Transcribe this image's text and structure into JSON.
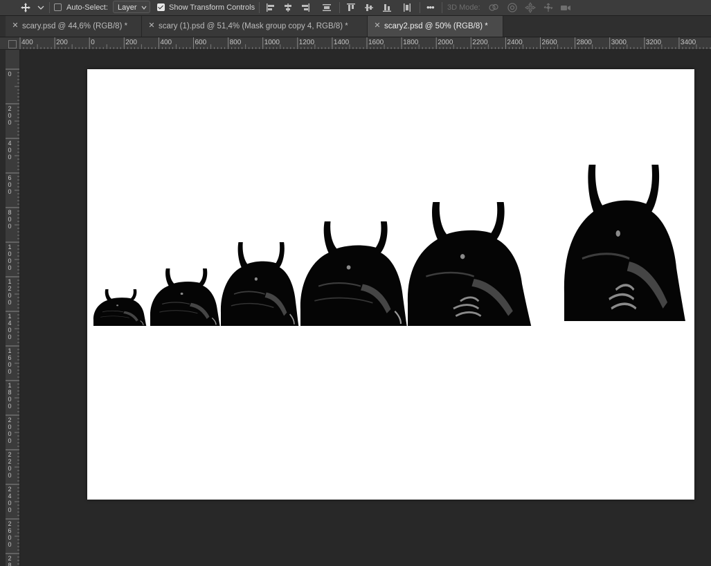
{
  "options_bar": {
    "auto_select_label": "Auto-Select:",
    "auto_select_checked": false,
    "auto_select_target": "Layer",
    "show_transform_label": "Show Transform Controls",
    "show_transform_checked": true,
    "more_label": "•••",
    "mode_3d_label": "3D Mode:",
    "icons": [
      "move-tool-icon",
      "chevron-down-icon",
      "align-left-icon",
      "align-center-icon",
      "align-right-icon",
      "distribute-icon",
      "align-top-icon",
      "align-middle-icon",
      "align-bottom-icon",
      "distribute-vertical-icon",
      "orbit-3d-icon",
      "roll-3d-icon",
      "pan-3d-icon",
      "slide-3d-icon",
      "camera-3d-icon"
    ]
  },
  "tabs": [
    {
      "title": "scary.psd @ 44,6% (RGB/8) *",
      "active": false
    },
    {
      "title": "scary (1).psd @ 51,4% (Mask group copy 4, RGB/8) *",
      "active": false
    },
    {
      "title": "scary2.psd @ 50% (RGB/8) *",
      "active": true
    }
  ],
  "rulers": {
    "horizontal_labels": [
      "400",
      "200",
      "0",
      "200",
      "400",
      "600",
      "800",
      "1000",
      "1200",
      "1400",
      "1600",
      "1800",
      "2000",
      "2200",
      "2400",
      "2600",
      "2800",
      "3000",
      "3200",
      "3400"
    ],
    "vertical_labels": [
      "0",
      "200",
      "400",
      "600",
      "800",
      "1000",
      "1200",
      "1400",
      "1600",
      "1800",
      "2000",
      "2200",
      "2400",
      "2600",
      "2800"
    ]
  },
  "canvas": {
    "background": "#ffffff",
    "monster_count": 6
  },
  "colors": {
    "app_background": "#282828",
    "options_bar": "#3c3c3c",
    "ruler": "#3b3b3b",
    "active_tab": "#4a4a4a"
  }
}
